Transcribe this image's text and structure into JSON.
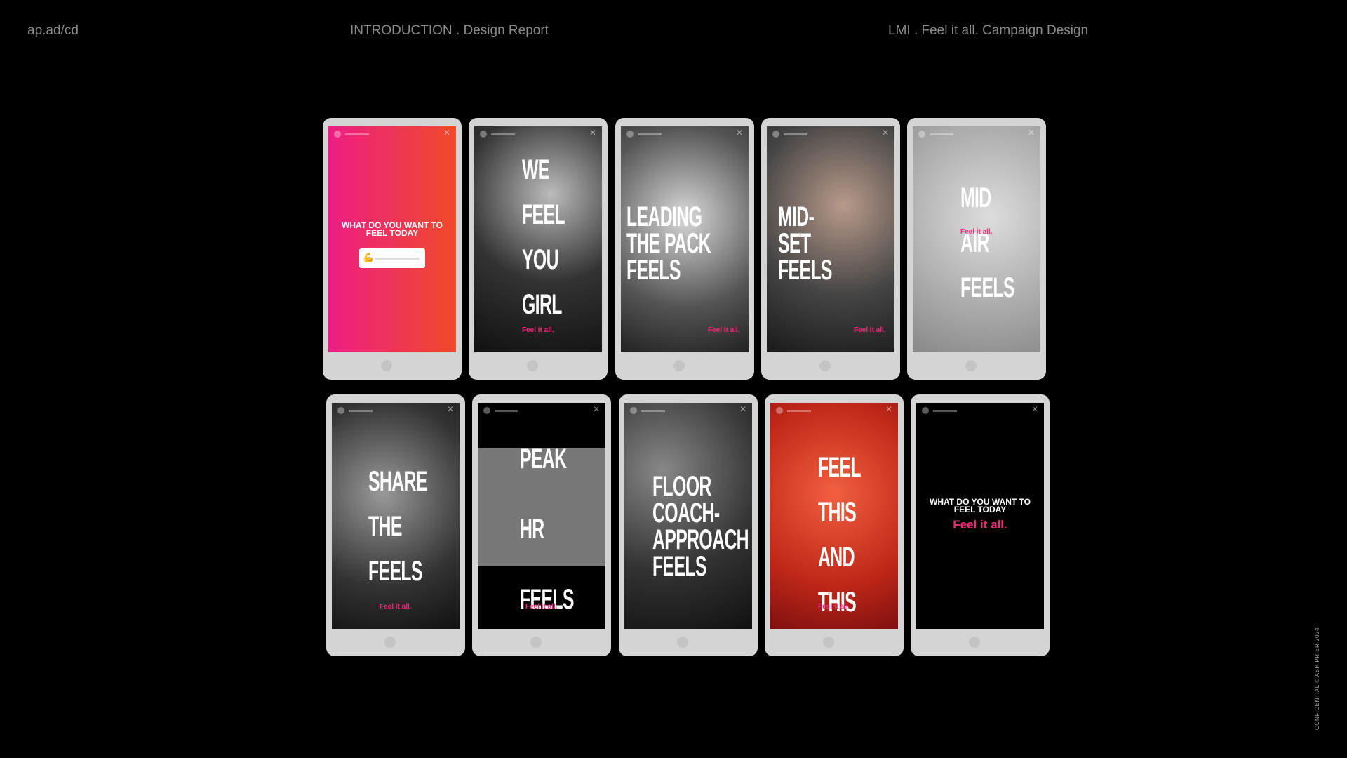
{
  "header": {
    "left": "ap.ad/cd",
    "center": "INTRODUCTION . Design Report",
    "right": "LMI . Feel it all. Campaign Design"
  },
  "footer": {
    "confidential": "CONFIDENTIAL © ASH PRIER 2024"
  },
  "colors": {
    "accent": "#ee2a7b",
    "gradient_start": "#ec1e84",
    "gradient_end": "#f04a2a",
    "bezel": "#d4d4d4"
  },
  "stories": [
    {
      "headline": "",
      "question": "WHAT DO YOU WANT TO FEEL TODAY",
      "slider_emoji": "💪",
      "tag": ""
    },
    {
      "headline": "WE\nFEEL\nYOU\nGIRL",
      "tag": "Feel it all."
    },
    {
      "headline": "LEADING\nTHE PACK\nFEELS",
      "tag": "Feel it all."
    },
    {
      "headline": "MID-\nSET\nFEELS",
      "tag": "Feel it all."
    },
    {
      "headline": "MID\nAIR\nFEELS",
      "tag": "Feel it all."
    },
    {
      "headline": "SHARE\nTHE\nFEELS",
      "tag": "Feel it all."
    },
    {
      "headline": "PEAK\nHR\nFEELS",
      "tag": "Feel it all."
    },
    {
      "headline": "FLOOR\nCOACH-\nAPPROACH\nFEELS",
      "tag": ""
    },
    {
      "headline": "FEEL\nTHIS\nAND\nTHIS",
      "tag": "Feel it all."
    },
    {
      "headline": "",
      "question": "WHAT DO YOU WANT TO FEEL TODAY",
      "tag": "Feel it all."
    }
  ]
}
